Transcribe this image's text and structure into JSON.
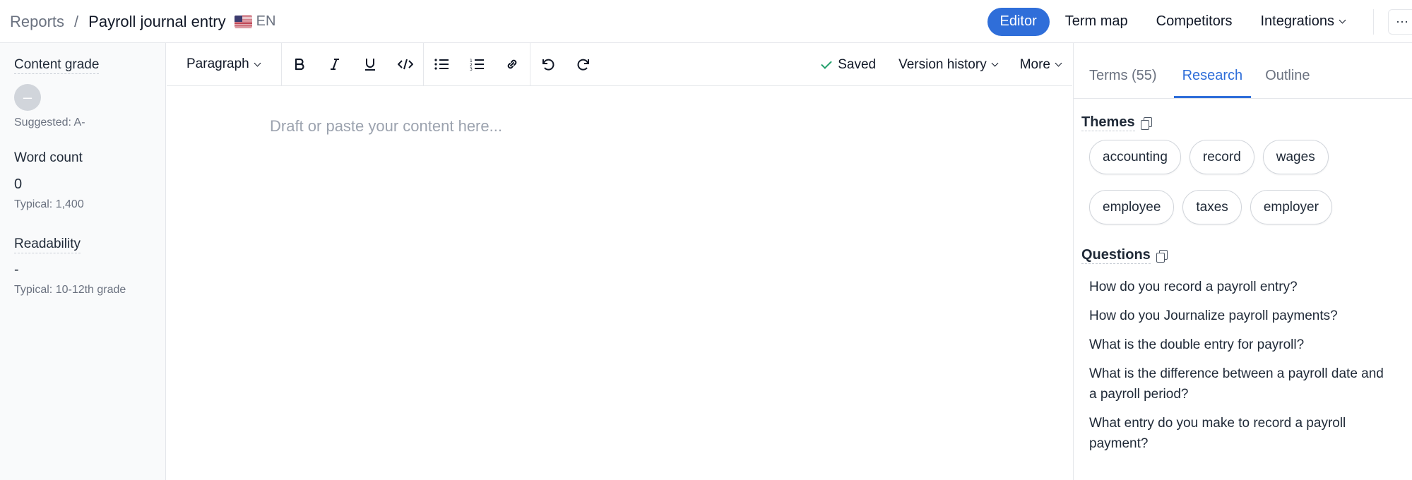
{
  "breadcrumb": {
    "parent": "Reports",
    "separator": "/",
    "title": "Payroll journal entry",
    "language": "EN"
  },
  "topnav": {
    "editor": "Editor",
    "term_map": "Term map",
    "competitors": "Competitors",
    "integrations": "Integrations",
    "more": "···"
  },
  "left": {
    "content_grade": {
      "label": "Content grade",
      "value": "–",
      "suggested": "Suggested: A-"
    },
    "word_count": {
      "label": "Word count",
      "value": "0",
      "typical": "Typical: 1,400"
    },
    "readability": {
      "label": "Readability",
      "value": "-",
      "typical": "Typical: 10-12th grade"
    }
  },
  "toolbar": {
    "paragraph": "Paragraph",
    "saved": "Saved",
    "version_history": "Version history",
    "more": "More"
  },
  "editor": {
    "placeholder": "Draft or paste your content here..."
  },
  "right": {
    "tabs": [
      "Terms (55)",
      "Research",
      "Outline"
    ],
    "themes_title": "Themes",
    "themes": [
      "accounting",
      "record",
      "wages",
      "employee",
      "taxes",
      "employer"
    ],
    "questions_title": "Questions",
    "questions": [
      "How do you record a payroll entry?",
      "How do you Journalize payroll payments?",
      "What is the double entry for payroll?",
      "What is the difference between a payroll date and a payroll period?",
      "What entry do you make to record a payroll payment?"
    ]
  }
}
